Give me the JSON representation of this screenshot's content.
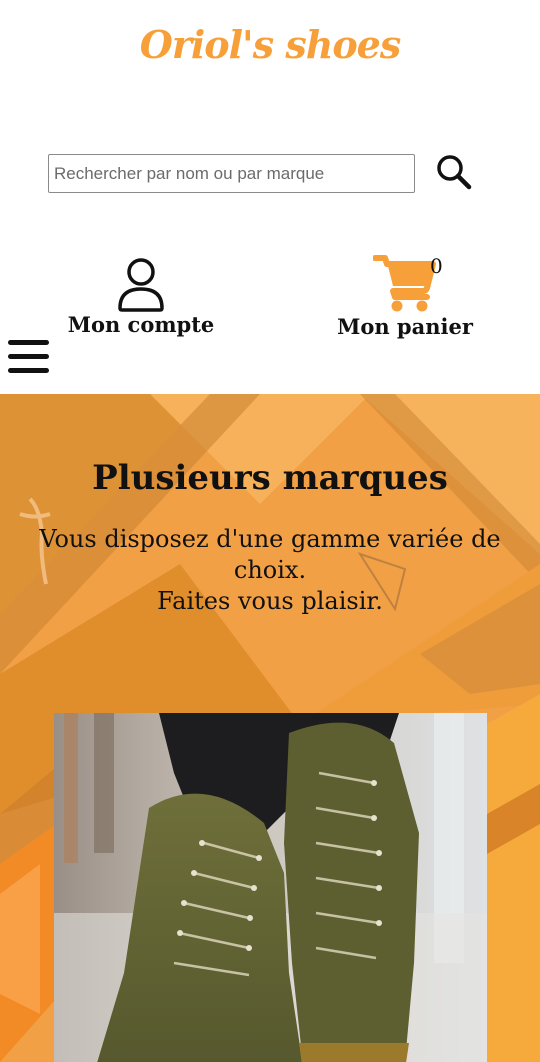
{
  "brand": {
    "name": "Oriol's shoes",
    "color": "#f7a03a"
  },
  "search": {
    "placeholder": "Rechercher par nom ou par marque",
    "value": "",
    "icon": "search-icon"
  },
  "account": {
    "label": "Mon compte",
    "icon": "user-icon"
  },
  "cart": {
    "label": "Mon panier",
    "count": "0",
    "icon": "cart-icon",
    "color": "#f7a03a"
  },
  "menu": {
    "icon": "hamburger-icon"
  },
  "hero": {
    "title": "Plusieurs marques",
    "line1": "Vous disposez d'une gamme variée de choix.",
    "line2": "Faites vous plaisir.",
    "background_color": "#f2a046",
    "product_image": "olive-green-high-top-sneakers-photo"
  }
}
